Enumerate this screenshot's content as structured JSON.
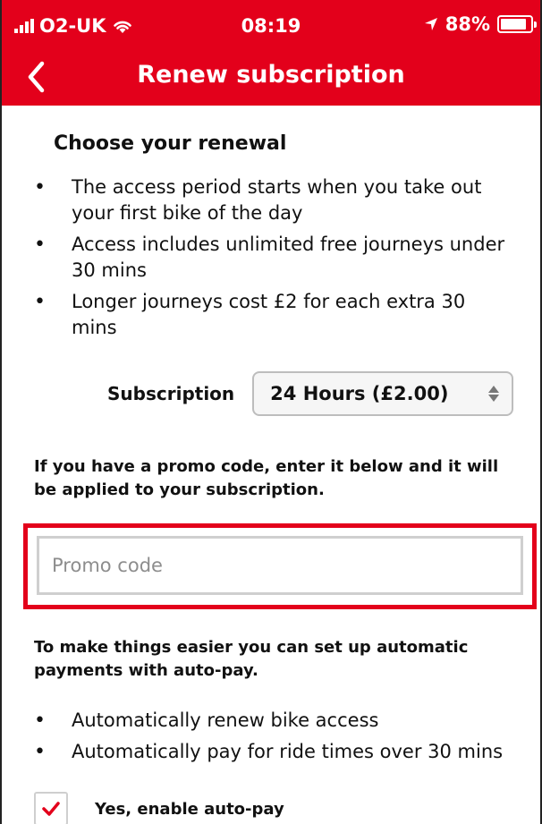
{
  "status_bar": {
    "carrier": "O2-UK",
    "time": "08:19",
    "battery": "88%",
    "battery_level": 0.88
  },
  "nav": {
    "title": "Renew subscription"
  },
  "renewal": {
    "title": "Choose your renewal",
    "bullets": [
      "The access period starts when you take out your first bike of the day",
      "Access includes unlimited free journeys under 30 mins",
      "Longer journeys cost £2 for each extra 30 mins"
    ]
  },
  "subscription": {
    "label": "Subscription",
    "selected": "24 Hours (£2.00)"
  },
  "promo": {
    "text": "If you have a promo code, enter it below and it will be applied to your subscription.",
    "placeholder": "Promo code",
    "value": ""
  },
  "autopay": {
    "text": "To make things easier you can set up automatic payments with auto-pay.",
    "bullets": [
      "Automatically renew bike access",
      "Automatically pay for ride times over 30 mins"
    ],
    "checkbox_label": "Yes, enable auto-pay",
    "checked": true
  },
  "colors": {
    "brand_red": "#e3001b",
    "highlight": "#e3001b"
  }
}
